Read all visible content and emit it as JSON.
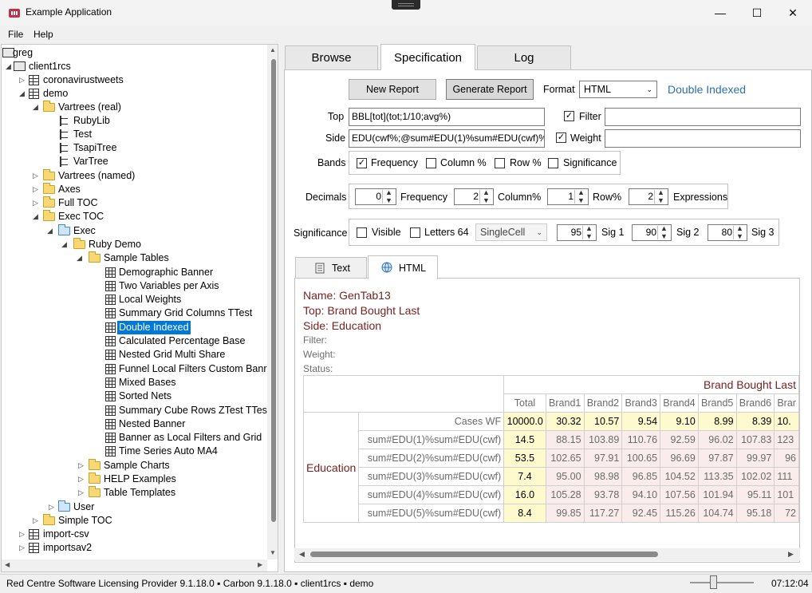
{
  "window": {
    "title": "Example Application",
    "minimize": "—",
    "maximize": "☐",
    "close": "✕"
  },
  "menu": {
    "file": "File",
    "help": "Help"
  },
  "tree": {
    "root_user": "greg",
    "items": [
      "client1rcs",
      "coronavirustweets",
      "demo",
      "Vartrees (real)",
      "RubyLib",
      "Test",
      "TsapiTree",
      "VarTree",
      "Vartrees (named)",
      "Axes",
      "Full TOC",
      "Exec TOC",
      "Exec",
      "Ruby Demo",
      "Sample Tables",
      "Demographic Banner",
      "Two Variables per Axis",
      "Local Weights",
      "Summary Grid Columns TTest",
      "Double Indexed",
      "Calculated Percentage Base",
      "Nested Grid Multi Share",
      "Funnel Local Filters Custom Banr",
      "Mixed Bases",
      "Sorted Nets",
      "Summary Cube Rows ZTest TTest",
      "Nested Banner",
      "Banner as Local Filters and Grid",
      "Time Series Auto MA4",
      "Sample Charts",
      "HELP Examples",
      "Table Templates",
      "User",
      "Simple TOC",
      "import-csv",
      "importsav2"
    ]
  },
  "tabs": {
    "browse": "Browse",
    "specification": "Specification",
    "log": "Log"
  },
  "spec": {
    "new_report": "New Report",
    "generate_report": "Generate Report",
    "format_label": "Format",
    "format_value": "HTML",
    "report_name": "Double Indexed",
    "top_label": "Top",
    "top_value": "BBL[tot](tot;1/10;avg%)",
    "side_label": "Side",
    "side_value": "EDU(cwf%;@sum#EDU(1)%sum#EDU(cwf)%;@",
    "filter_label": "Filter",
    "filter_value": "",
    "weight_label": "Weight",
    "weight_value": "",
    "filter_checked": true,
    "weight_checked": true,
    "bands_label": "Bands",
    "bands": {
      "frequency": "Frequency",
      "column": "Column %",
      "row": "Row %",
      "significance": "Significance"
    },
    "bands_checked": {
      "frequency": true,
      "column": false,
      "row": false,
      "significance": false
    },
    "decimals_label": "Decimals",
    "decimals": {
      "frequency": "0",
      "frequency_label": "Frequency",
      "column": "2",
      "column_label": "Column%",
      "row": "1",
      "row_label": "Row%",
      "expressions": "2",
      "expressions_label": "Expressions"
    },
    "significance_label": "Significance",
    "sig": {
      "visible": "Visible",
      "letters": "Letters 64",
      "mode": "SingleCell",
      "sig1": "95",
      "sig1_label": "Sig 1",
      "sig2": "90",
      "sig2_label": "Sig 2",
      "sig3": "80",
      "sig3_label": "Sig 3"
    }
  },
  "subtabs": {
    "text": "Text",
    "html": "HTML"
  },
  "report": {
    "name": "Name: GenTab13",
    "top": "Top: Brand Bought Last",
    "side": "Side: Education",
    "filter": "Filter:",
    "weight": "Weight:",
    "status": "Status:",
    "top_header": "Brand Bought Last",
    "columns": [
      "Total",
      "Brand1",
      "Brand2",
      "Brand3",
      "Brand4",
      "Brand5",
      "Brand6",
      "Brar"
    ],
    "side_header": "Education",
    "rows": [
      {
        "label": "Cases WF",
        "values": [
          "10000.0",
          "30.32",
          "10.57",
          "9.54",
          "9.10",
          "8.99",
          "8.39",
          "10."
        ]
      },
      {
        "label": "sum#EDU(1)%sum#EDU(cwf)",
        "values": [
          "14.5",
          "88.15",
          "103.89",
          "110.76",
          "92.59",
          "96.02",
          "107.83",
          "123"
        ]
      },
      {
        "label": "sum#EDU(2)%sum#EDU(cwf)",
        "values": [
          "53.5",
          "102.65",
          "97.91",
          "100.65",
          "96.69",
          "97.87",
          "99.97",
          "96"
        ]
      },
      {
        "label": "sum#EDU(3)%sum#EDU(cwf)",
        "values": [
          "7.4",
          "95.00",
          "98.98",
          "96.85",
          "104.52",
          "113.35",
          "102.02",
          "111"
        ]
      },
      {
        "label": "sum#EDU(4)%sum#EDU(cwf)",
        "values": [
          "16.0",
          "105.28",
          "93.78",
          "94.10",
          "107.56",
          "101.94",
          "95.11",
          "101"
        ]
      },
      {
        "label": "sum#EDU(5)%sum#EDU(cwf)",
        "values": [
          "8.4",
          "99.85",
          "117.27",
          "92.45",
          "115.26",
          "104.74",
          "95.18",
          "72"
        ]
      }
    ]
  },
  "status": {
    "text": "Red Centre Software Licensing Provider 9.1.18.0 ▪ Carbon 9.1.18.0 ▪ client1rcs ▪ demo",
    "clock": "07:12:04"
  },
  "colors": {
    "accent": "#0078d7",
    "report_title": "#7a1f1f",
    "cell_yellow": "#fffacd",
    "cell_pink": "#fbecec",
    "link_blue": "#2e6fae"
  }
}
